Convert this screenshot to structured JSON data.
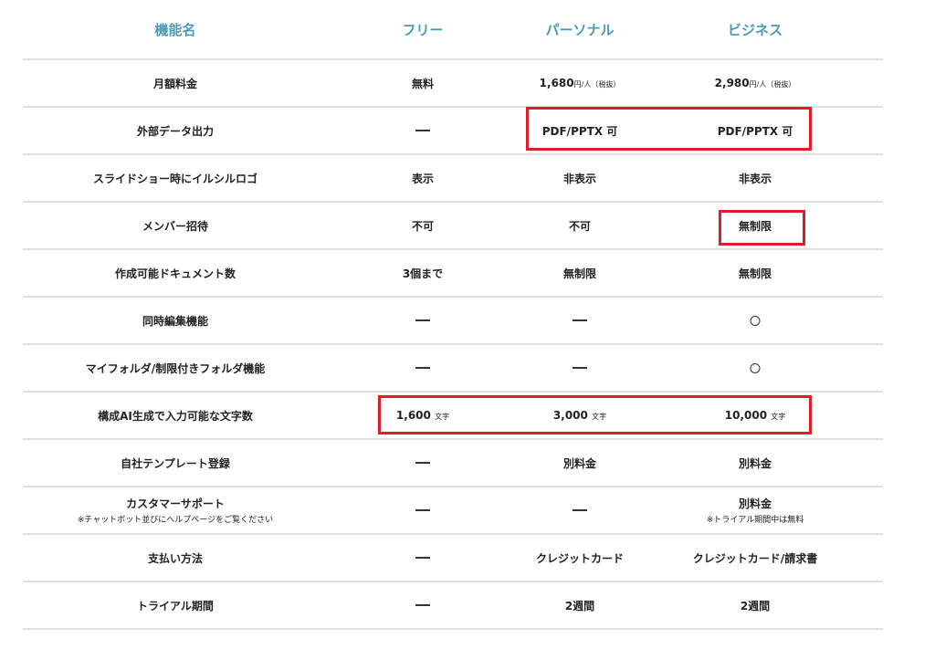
{
  "header": {
    "feature": "機能名",
    "free": "フリー",
    "personal": "パーソナル",
    "business": "ビジネス"
  },
  "rows": [
    {
      "feature": "月額料金",
      "free": "無料",
      "personal": {
        "main": "1,680",
        "suffix": "円/人（税抜）"
      },
      "business": {
        "main": "2,980",
        "suffix": "円/人（税抜）"
      }
    },
    {
      "feature": "外部データ出力",
      "free": "—",
      "personal": "PDF/PPTX 可",
      "business": "PDF/PPTX 可"
    },
    {
      "feature": "スライドショー時にイルシルロゴ",
      "free": "表示",
      "personal": "非表示",
      "business": "非表示"
    },
    {
      "feature": "メンバー招待",
      "free": "不可",
      "personal": "不可",
      "business": "無制限"
    },
    {
      "feature": "作成可能ドキュメント数",
      "free": "3個まで",
      "personal": "無制限",
      "business": "無制限"
    },
    {
      "feature": "同時編集機能",
      "free": "—",
      "personal": "—",
      "business": "○"
    },
    {
      "feature": "マイフォルダ/制限付きフォルダ機能",
      "free": "—",
      "personal": "—",
      "business": "○"
    },
    {
      "feature": "構成AI生成で入力可能な文字数",
      "free": {
        "main": "1,600",
        "suffix": "文字"
      },
      "personal": {
        "main": "3,000",
        "suffix": "文字"
      },
      "business": {
        "main": "10,000",
        "suffix": "文字"
      }
    },
    {
      "feature": "自社テンプレート登録",
      "free": "—",
      "personal": "別料金",
      "business": "別料金"
    },
    {
      "feature": "カスタマーサポート",
      "feature_note": "※チャットボット並びにヘルプページをご覧ください",
      "free": "—",
      "personal": "—",
      "business": "別料金",
      "business_note": "※トライアル期間中は無料"
    },
    {
      "feature": "支払い方法",
      "free": "—",
      "personal": "クレジットカード",
      "business": "クレジットカード/請求書"
    },
    {
      "feature": "トライアル期間",
      "free": "—",
      "personal": "2週間",
      "business": "2週間"
    }
  ],
  "highlight_color": "#e01e2a",
  "header_color": "#4a9cb5",
  "icons": {
    "dash": "em-dash",
    "circle": "available-circle-icon"
  }
}
